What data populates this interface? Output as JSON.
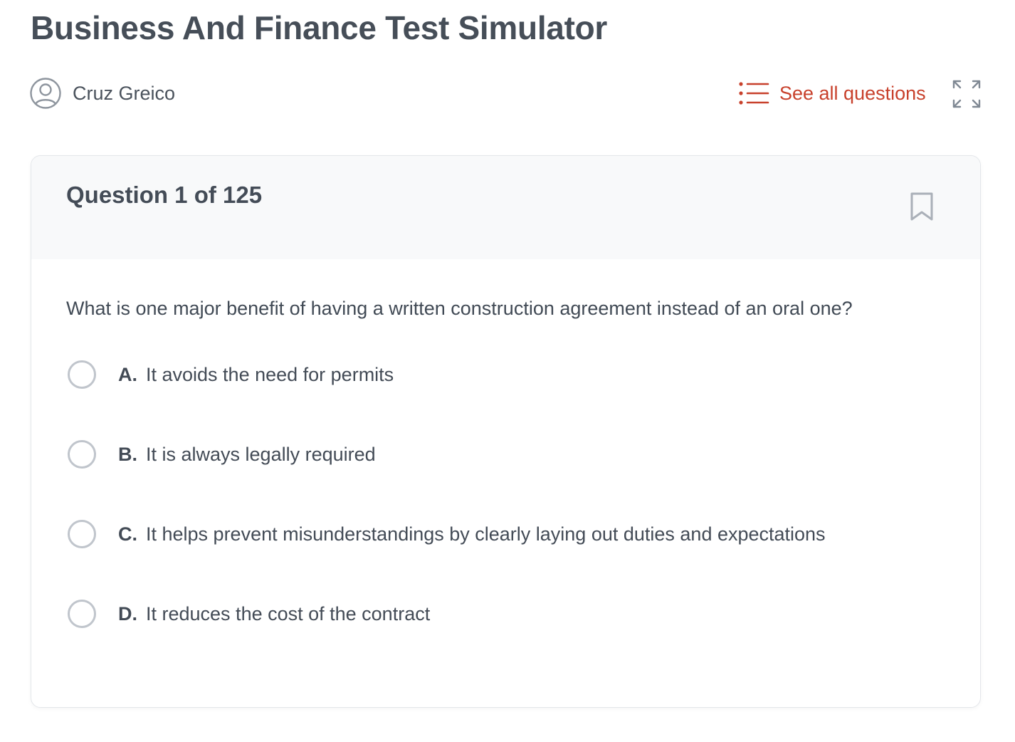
{
  "page": {
    "title": "Business And Finance Test Simulator"
  },
  "user": {
    "name": "Cruz Greico",
    "avatar_icon": "user-circle-icon"
  },
  "toolbar": {
    "see_all_label": "See all questions",
    "see_all_icon": "list-icon",
    "expand_icon": "expand-icon",
    "accent_color": "#c8412c"
  },
  "question": {
    "counter": "Question 1 of 125",
    "bookmark_icon": "bookmark-icon",
    "text": "What is one major benefit of having a written construction agreement instead of an oral one?",
    "options": [
      {
        "letter": "A.",
        "text": "It avoids the need for permits"
      },
      {
        "letter": "B.",
        "text": " It is always legally required"
      },
      {
        "letter": "C.",
        "text": "It helps prevent misunderstandings by clearly laying out duties and expectations"
      },
      {
        "letter": "D.",
        "text": " It reduces the cost of the contract"
      }
    ]
  }
}
